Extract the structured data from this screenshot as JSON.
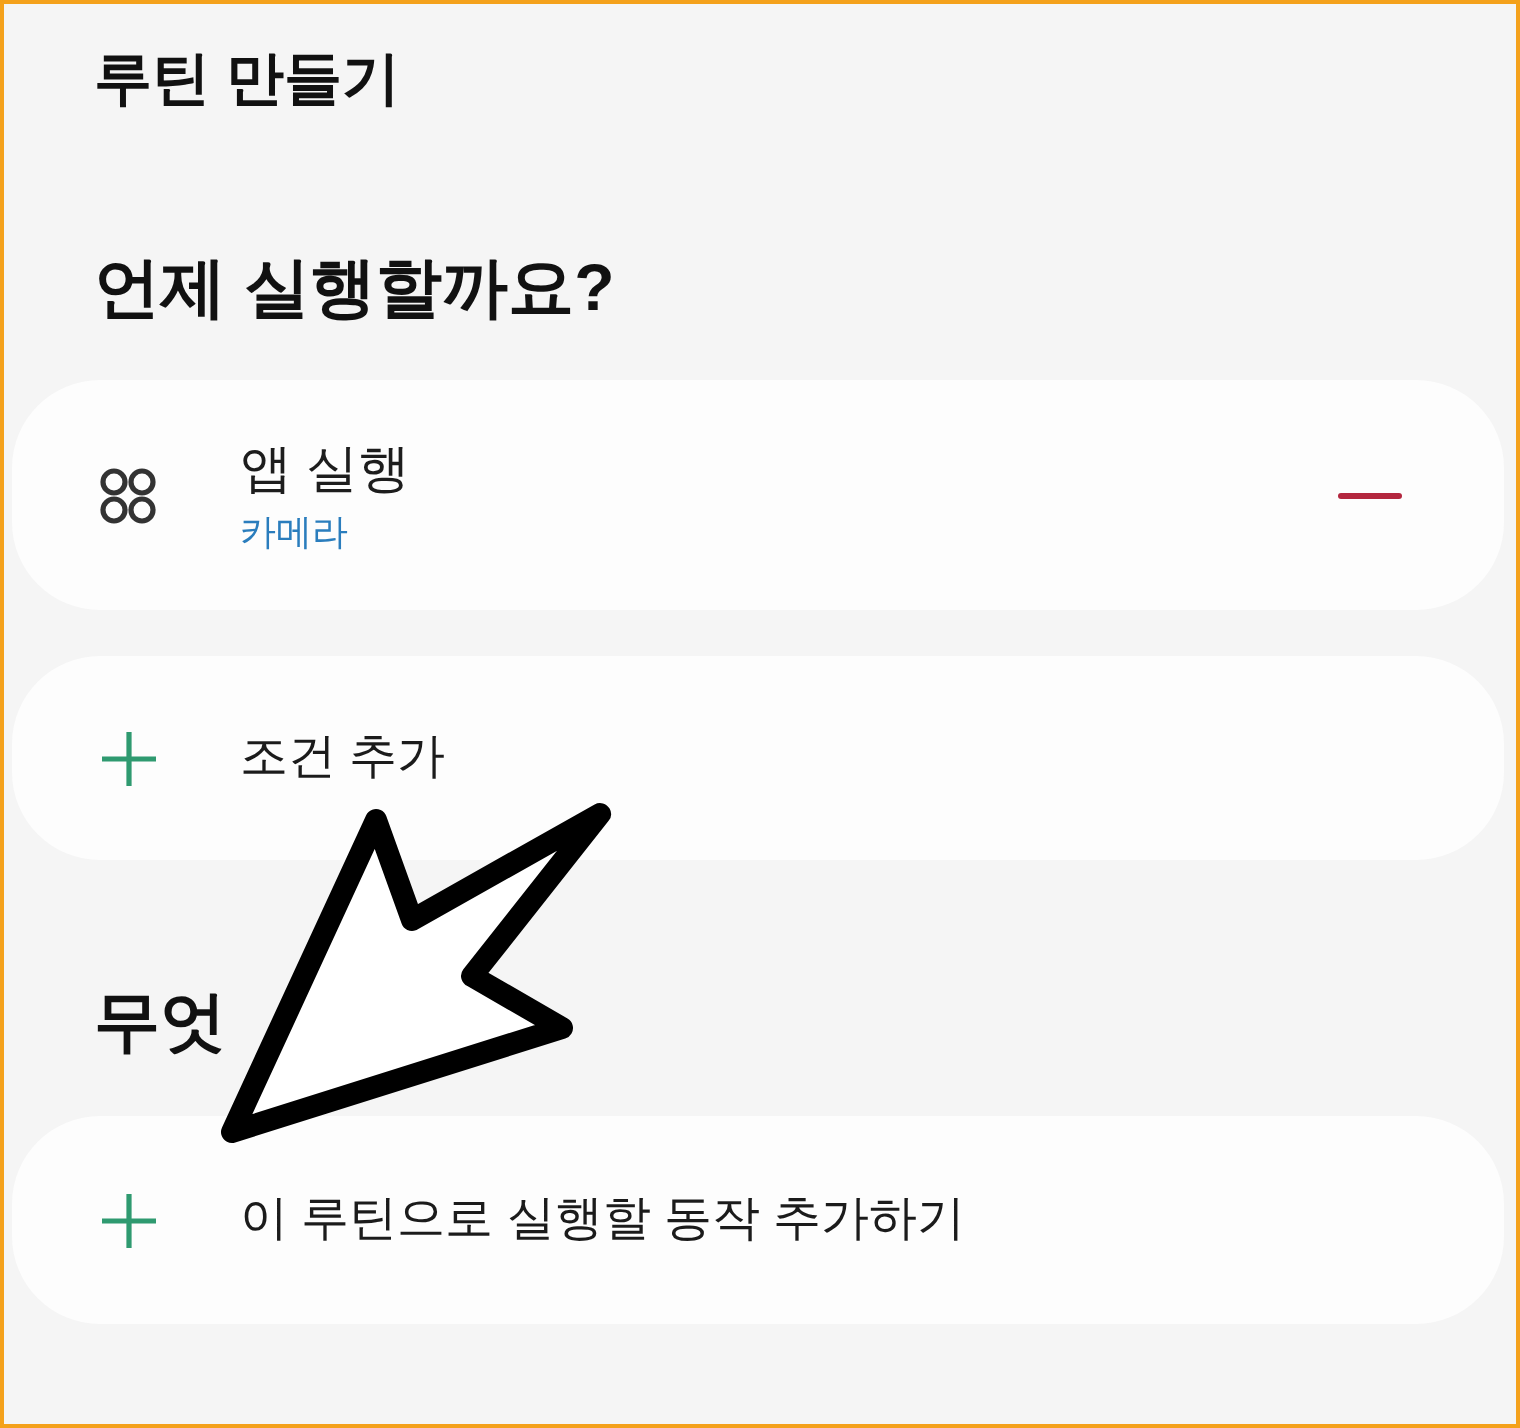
{
  "title": "루틴 만들기",
  "sections": [
    {
      "heading": "언제 실행할까요?",
      "items": [
        {
          "kind": "condition",
          "title": "앱 실행",
          "value": "카메라",
          "removable": true
        },
        {
          "kind": "add",
          "label": "조건 추가"
        }
      ]
    },
    {
      "heading": "무엇",
      "items": [
        {
          "kind": "add",
          "label": "이 루틴으로 실행할 동작 추가하기"
        }
      ]
    }
  ],
  "annotations": [
    {
      "kind": "arrow"
    }
  ]
}
